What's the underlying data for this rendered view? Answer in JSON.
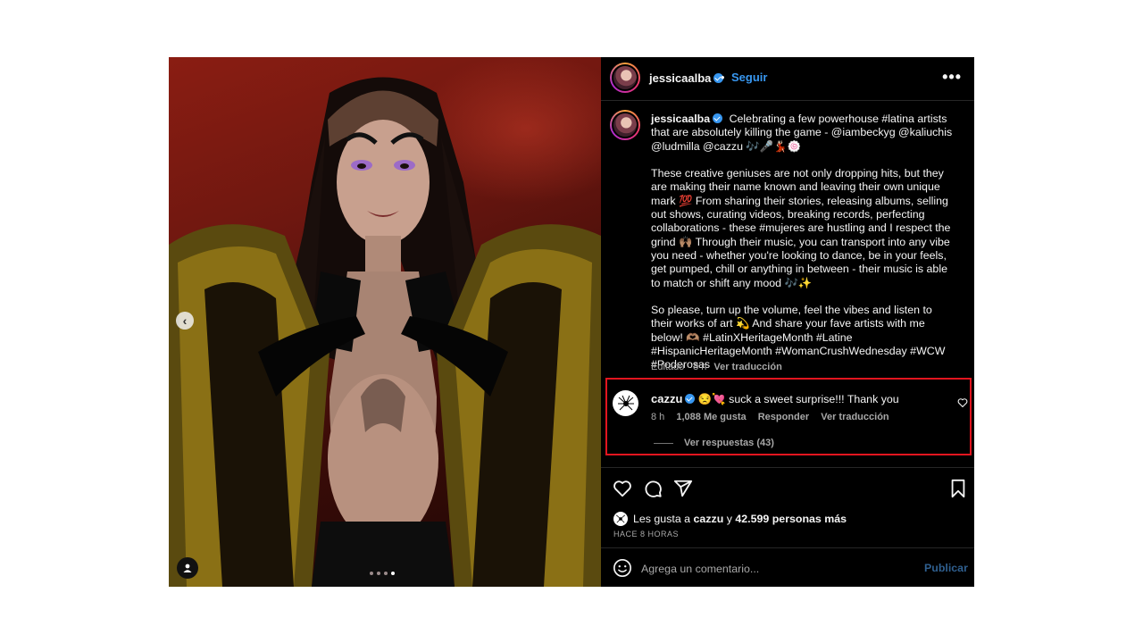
{
  "post": {
    "author": "jessicaalba",
    "follow_label": "Seguir",
    "dot": "•",
    "more_label": "•••",
    "caption_paragraphs": [
      "Celebrating a few powerhouse #latina artists that are absolutely killing the game - @iambeckyg @kaliuchis @ludmilla @cazzu 🎶🎤💃🏻🍥",
      "These creative geniuses are not only dropping hits, but they are making their name known and leaving their own unique mark 💯 From sharing their stories, releasing albums, selling out shows, curating videos, breaking records, perfecting collaborations - these #mujeres are hustling and I respect the grind 🙌🏽 Through their music, you can transport into any vibe you need - whether you're looking to dance, be in your feels, get pumped, chill or anything in between - their music is able to match or shift any mood 🎶✨",
      "So please, turn up the volume, feel the vibes and listen to their works of art 💫 And share your fave artists with me below! 🫶🏽 #LatinXHeritageMonth #Latine #HispanicHeritageMonth #WomanCrushWednesday #WCW #Poderosas"
    ],
    "meta_time": "Editado · 8 h",
    "meta_translate": "Ver traducción",
    "carousel_count": 4,
    "carousel_active": 4
  },
  "comment": {
    "author": "cazzu",
    "text": "😒💘 suck a sweet surprise!!! Thank you",
    "time": "8 h",
    "likes": "1,088 Me gusta",
    "reply": "Responder",
    "translate": "Ver traducción",
    "view_replies": "Ver respuestas (43)"
  },
  "likes": {
    "prefix": "Les gusta a",
    "user": "cazzu",
    "joiner": "y",
    "others": "42.599 personas más"
  },
  "timestamp": "HACE 8 HORAS",
  "composer": {
    "placeholder": "Agrega un comentario...",
    "publish_label": "Publicar"
  },
  "colors": {
    "panel_bg": "#000000",
    "link_blue": "#3897f0",
    "highlight_red": "#e2151f"
  },
  "icons": [
    "chevron-left-icon",
    "user-tag-icon",
    "more-icon",
    "verified-icon",
    "heart-icon",
    "comment-icon",
    "share-icon",
    "bookmark-icon",
    "emoji-icon"
  ]
}
